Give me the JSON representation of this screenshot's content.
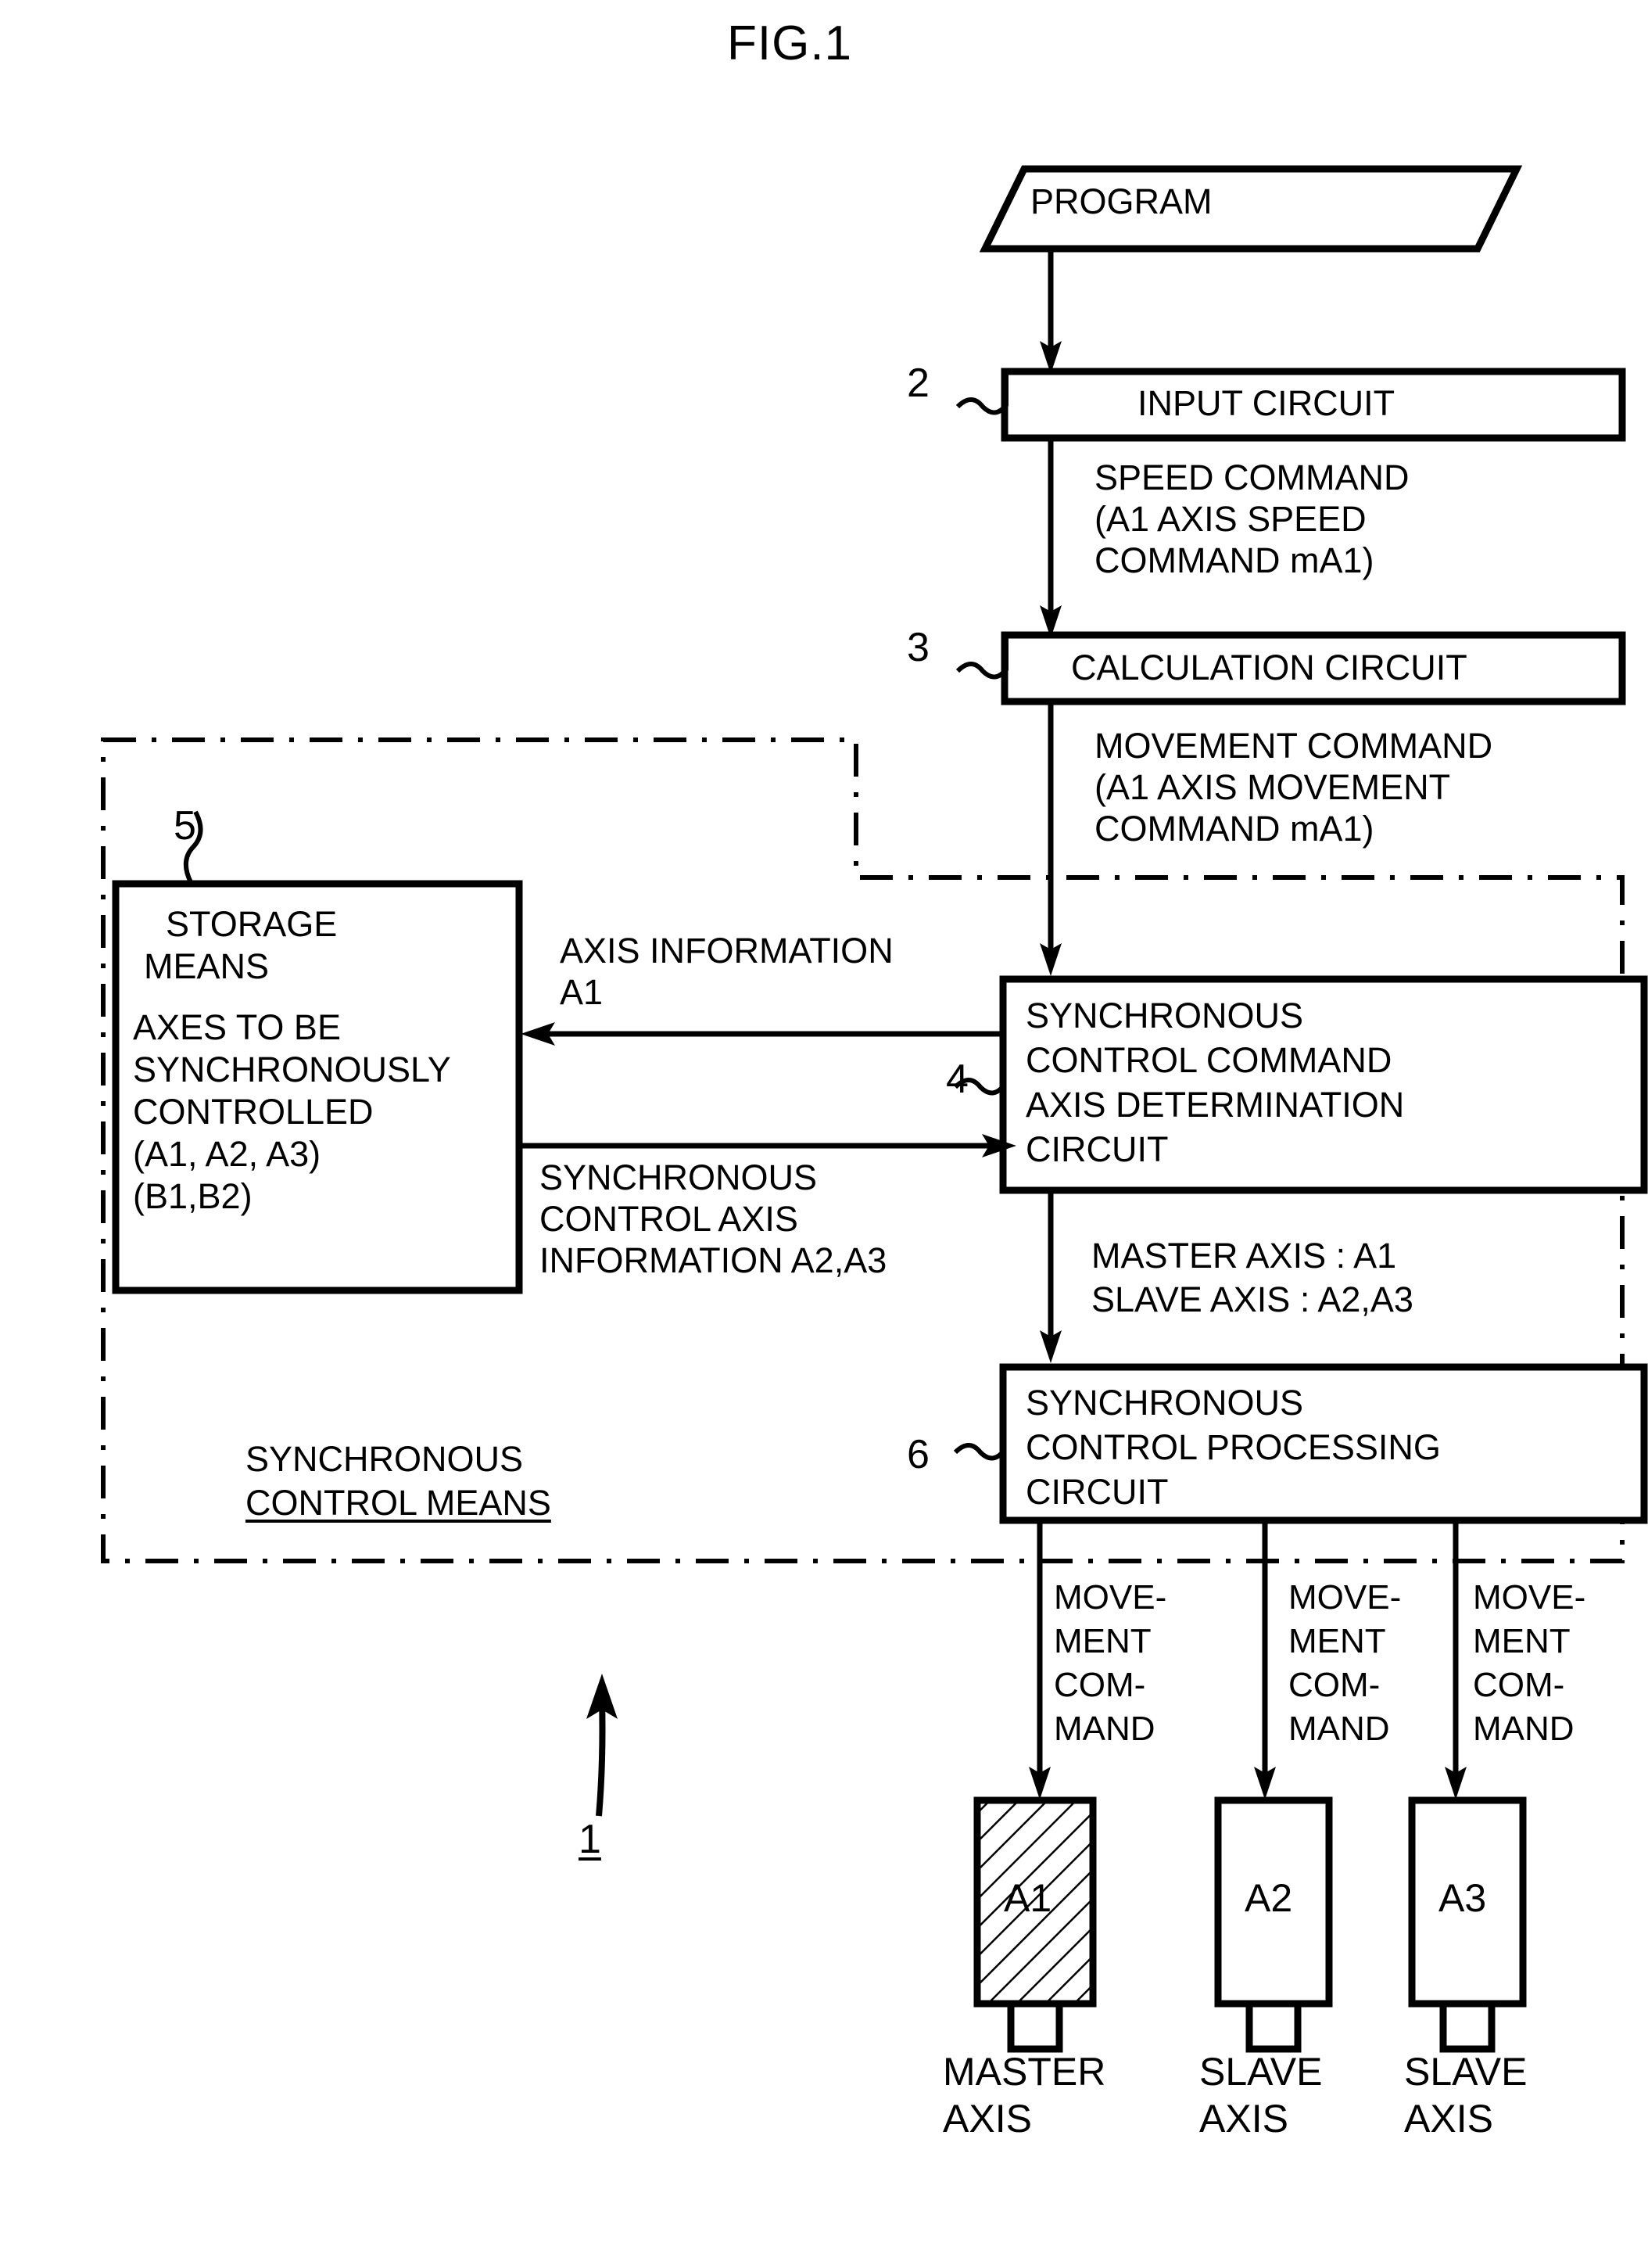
{
  "figure": {
    "title": "FIG.1",
    "overall_ref": "1"
  },
  "nodes": {
    "program": {
      "label": "PROGRAM",
      "shape": "parallelogram"
    },
    "input_circuit": {
      "label": "INPUT CIRCUIT",
      "ref": "2"
    },
    "calculation_circuit": {
      "label": "CALCULATION CIRCUIT",
      "ref": "3"
    },
    "determination_circuit": {
      "ref": "4",
      "lines": [
        "SYNCHRONOUS",
        "CONTROL COMMAND",
        "AXIS DETERMINATION",
        "CIRCUIT"
      ]
    },
    "storage_means": {
      "ref": "5",
      "lines": [
        "STORAGE",
        "MEANS"
      ],
      "body_lines": [
        "AXES TO BE",
        "SYNCHRONOUSLY",
        "CONTROLLED",
        "(A1, A2, A3)",
        "(B1,B2)"
      ]
    },
    "processing_circuit": {
      "ref": "6",
      "lines": [
        "SYNCHRONOUS",
        "CONTROL PROCESSING",
        "CIRCUIT"
      ]
    },
    "synchronous_control_means": {
      "line1": "SYNCHRONOUS",
      "line2": "CONTROL MEANS"
    }
  },
  "edge_labels": {
    "speed_command": [
      "SPEED COMMAND",
      "(A1 AXIS SPEED",
      "COMMAND mA1)"
    ],
    "movement_command": [
      "MOVEMENT COMMAND",
      "(A1 AXIS MOVEMENT",
      "COMMAND mA1)"
    ],
    "axis_information": [
      "AXIS INFORMATION",
      "A1"
    ],
    "sync_control_axis_information": [
      "SYNCHRONOUS",
      "CONTROL AXIS",
      "INFORMATION A2,A3"
    ],
    "master_slave": [
      "MASTER AXIS : A1",
      "SLAVE AXIS : A2,A3"
    ],
    "movement_command_stack": [
      "MOVE-",
      "MENT",
      "COM-",
      "MAND"
    ]
  },
  "motors": [
    {
      "label": "A1",
      "role_line1": "MASTER",
      "role_line2": "AXIS",
      "hatched": true
    },
    {
      "label": "A2",
      "role_line1": "SLAVE",
      "role_line2": "AXIS",
      "hatched": false
    },
    {
      "label": "A3",
      "role_line1": "SLAVE",
      "role_line2": "AXIS",
      "hatched": false
    }
  ],
  "colors": {
    "ink": "#000000",
    "paper": "#ffffff"
  }
}
